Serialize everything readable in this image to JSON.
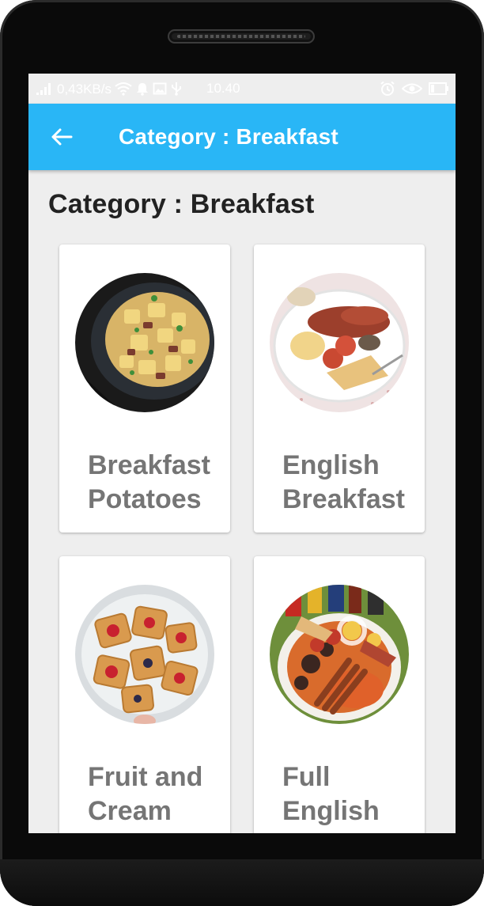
{
  "status_bar": {
    "speed": "0,43KB/s",
    "time": "10.40"
  },
  "app_bar": {
    "back_icon": "arrow-left-icon",
    "title": "Category : Breakfast"
  },
  "page": {
    "heading": "Category : Breakfast"
  },
  "items": [
    {
      "label": "Breakfast Potatoes",
      "image": "breakfast-potatoes-photo"
    },
    {
      "label": "English Breakfast",
      "image": "english-breakfast-photo"
    },
    {
      "label": "Fruit and Cream Cheese",
      "image": "fruit-cream-pastry-photo"
    },
    {
      "label": "Full English Breakfast",
      "image": "full-english-breakfast-photo"
    }
  ],
  "colors": {
    "app_bar": "#29b6f6",
    "background": "#eeeeee",
    "card_text": "#757575"
  }
}
